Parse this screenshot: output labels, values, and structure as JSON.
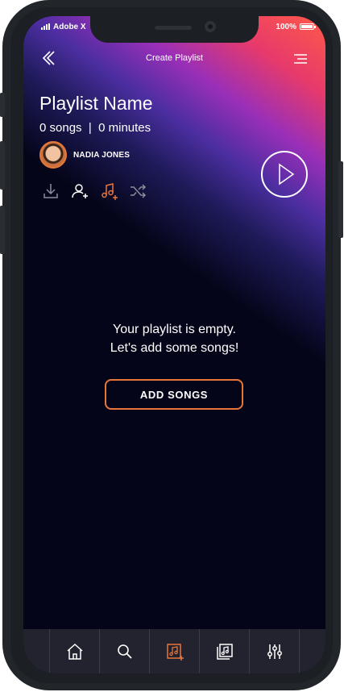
{
  "status_bar": {
    "carrier": "Adobe X",
    "battery": "100%"
  },
  "header": {
    "title": "Create Playlist"
  },
  "playlist": {
    "name": "Playlist Name",
    "meta": "0 songs  |  0 minutes",
    "owner": "NADIA JONES"
  },
  "actions": {
    "icons": [
      "download-icon",
      "add-user-icon",
      "add-music-icon",
      "shuffle-icon"
    ],
    "active_color": "#e8753a"
  },
  "empty_state": {
    "line1": "Your playlist is empty.",
    "line2": "Let's add some songs!"
  },
  "add_button": {
    "label": "ADD SONGS"
  },
  "bottom_nav": {
    "items": [
      "home-icon",
      "search-icon",
      "playlist-add-icon",
      "library-icon",
      "equalizer-icon"
    ],
    "active": "playlist-add-icon"
  },
  "colors": {
    "accent": "#e8753a",
    "background": "#05051a",
    "gradient_top": "#ff5a48"
  }
}
